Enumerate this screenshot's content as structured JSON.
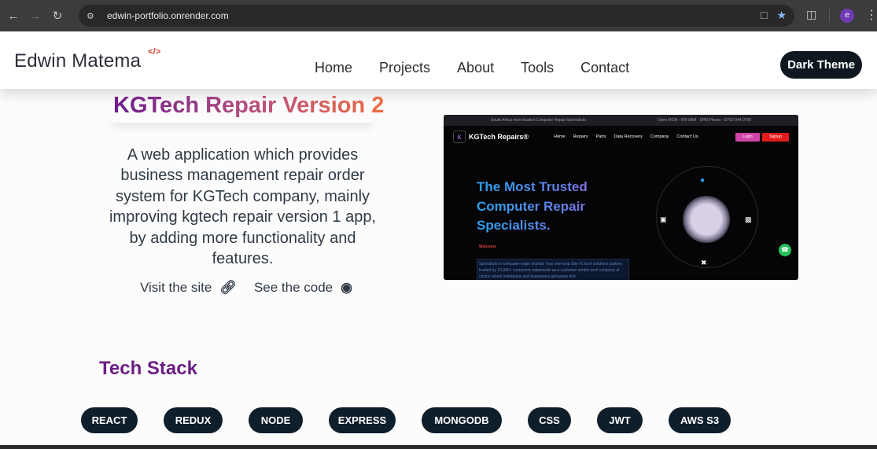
{
  "browser": {
    "url": "edwin-portfolio.onrender.com",
    "profile_initial": "e",
    "icons": {
      "back": "arrow-left-icon",
      "forward": "arrow-right-icon",
      "reload": "reload-icon",
      "site_info": "site-settings-icon",
      "install": "install-app-icon",
      "bookmark": "star-icon",
      "extensions": "puzzle-icon",
      "menu": "kebab-menu-icon"
    },
    "accent": "#8ab4f8"
  },
  "header": {
    "logo": "Edwin Matema",
    "logo_code": "</>",
    "nav": [
      "Home",
      "Projects",
      "About",
      "Tools",
      "Contact"
    ],
    "theme_button": "Dark Theme"
  },
  "project": {
    "title": "KGTech Repair Version 2",
    "description": "A web application which provides business management repair order system for KGTech company, mainly improving kgtech repair version 1 app, by adding more functionality and features.",
    "visit_label": "Visit the site",
    "code_label": "See the code",
    "title_gradient": [
      "#6b1d8e",
      "#ef6e43"
    ]
  },
  "preview": {
    "topbar_left": "South Africa most trusted Computer Repair Specialists",
    "topbar_right": "Open MON - FRI 8AM - 5PM      Phone: +2762 844 0756",
    "brand": "KGTech Repairs®",
    "nav": [
      "Home",
      "Repairs",
      "Parts",
      "Data Recovery",
      "Company",
      "Contact Us"
    ],
    "login": "Login",
    "signup": "Signup",
    "headline": "The Most Trusted Computer Repair Specialists.",
    "welcome": "Welcome",
    "blurb": "Specialists in computer major brands! Your one-stop Site #1 tech solutions partner, trusted by 10,000+ customers nationwide as a customer-centric tech company of choice where individuals and businesses genuinely find"
  },
  "tech": {
    "title": "Tech Stack",
    "items": [
      "REACT",
      "REDUX",
      "NODE",
      "EXPRESS",
      "MONGODB",
      "CSS",
      "JWT",
      "AWS S3"
    ]
  }
}
